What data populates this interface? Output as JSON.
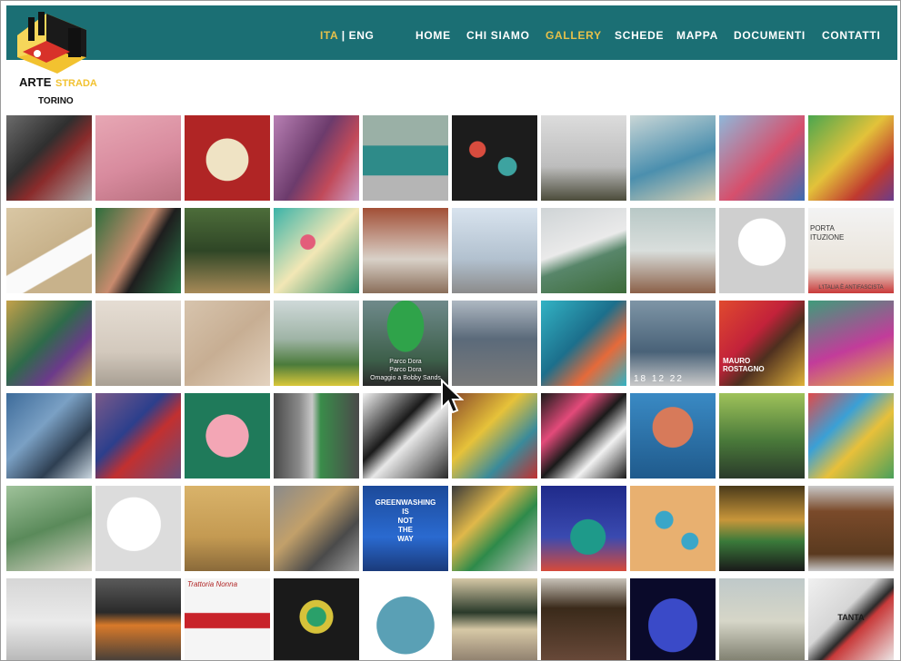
{
  "brand": {
    "logo_text_left": "ARTE",
    "logo_text_right": "STRADA",
    "logo_city": "TORINO"
  },
  "lang": {
    "ita": "ITA",
    "sep": "|",
    "eng": "ENG"
  },
  "nav": {
    "items": [
      "HOME",
      "CHI SIAMO",
      "GALLERY",
      "SCHEDE",
      "MAPPA",
      "DOCUMENTI",
      "CONTATTI"
    ],
    "current": "GALLERY"
  },
  "colors": {
    "header_bg": "#1b6f74",
    "nav_text": "#ffffff",
    "accent": "#e7c14a"
  },
  "gallery": {
    "hover_tile": {
      "line1": "Parco Dora",
      "line2": "Parco Dora",
      "line3": "Omaggio a Bobby Sands"
    },
    "tile_text": {
      "greenwashing": [
        "GREENWASHING",
        "IS",
        "NOT",
        "THE",
        "WAY"
      ],
      "porta": [
        "PORTA",
        "ITUZIONE"
      ],
      "italia": "L'ITALIA È ANTIFASCISTA",
      "trattoria": "Trattoria",
      "nonna": "Nonna",
      "mauro": [
        "MAURO",
        "ROSTAGNO"
      ],
      "date": "18 12 22",
      "tanta": "TANTA"
    }
  }
}
